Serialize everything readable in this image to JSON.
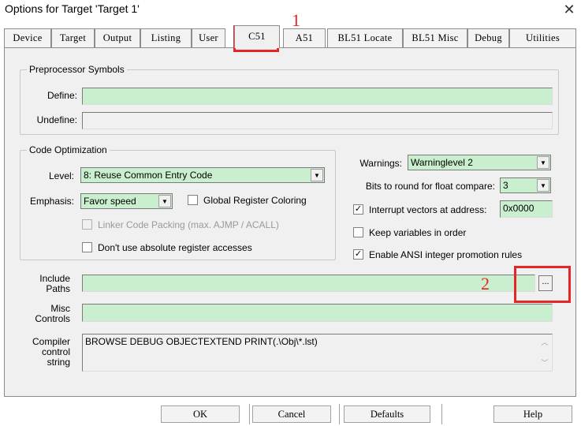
{
  "window": {
    "title": "Options for Target 'Target 1'",
    "close_glyph": "✕"
  },
  "tabs": [
    {
      "label": "Device"
    },
    {
      "label": "Target"
    },
    {
      "label": "Output"
    },
    {
      "label": "Listing"
    },
    {
      "label": "User"
    },
    {
      "label": "C51"
    },
    {
      "label": "A51"
    },
    {
      "label": "BL51 Locate"
    },
    {
      "label": "BL51 Misc"
    },
    {
      "label": "Debug"
    },
    {
      "label": "Utilities"
    }
  ],
  "preprocessor": {
    "group_label": "Preprocessor Symbols",
    "define_label": "Define:",
    "define_value": "",
    "undefine_label": "Undefine:",
    "undefine_value": ""
  },
  "code_optimization": {
    "group_label": "Code Optimization",
    "level_label": "Level:",
    "level_value": "8: Reuse Common Entry Code",
    "emphasis_label": "Emphasis:",
    "emphasis_value": "Favor speed",
    "global_register_coloring": {
      "label": "Global Register Coloring",
      "checked": false
    },
    "linker_code_packing": {
      "label": "Linker Code Packing (max. AJMP / ACALL)",
      "checked": false,
      "disabled": true
    },
    "no_absolute_register": {
      "label": "Don't use absolute register accesses",
      "checked": false
    }
  },
  "right": {
    "warnings_label": "Warnings:",
    "warnings_value": "Warninglevel 2",
    "bits_label": "Bits to round for float compare:",
    "bits_value": "3",
    "interrupt_vectors": {
      "label": "Interrupt vectors at address:",
      "checked": true,
      "value": "0x0000"
    },
    "keep_variables": {
      "label": "Keep variables in order",
      "checked": false
    },
    "ansi_integer": {
      "label": "Enable ANSI integer promotion rules",
      "checked": true
    }
  },
  "paths": {
    "include_label_1": "Include",
    "include_label_2": "Paths",
    "include_value": "",
    "browse_label": "...",
    "misc_label_1": "Misc",
    "misc_label_2": "Controls",
    "misc_value": "",
    "compiler_label_1": "Compiler",
    "compiler_label_2": "control",
    "compiler_label_3": "string",
    "compiler_value": "BROWSE DEBUG OBJECTEXTEND PRINT(.\\Obj\\*.lst)"
  },
  "annotations": {
    "one": "1",
    "two": "2",
    "color": "#e52626"
  },
  "buttons": {
    "ok": "OK",
    "cancel": "Cancel",
    "defaults": "Defaults",
    "help": "Help"
  },
  "colors": {
    "field_green": "#c9efce",
    "panel_bg": "#f0f0f0"
  }
}
